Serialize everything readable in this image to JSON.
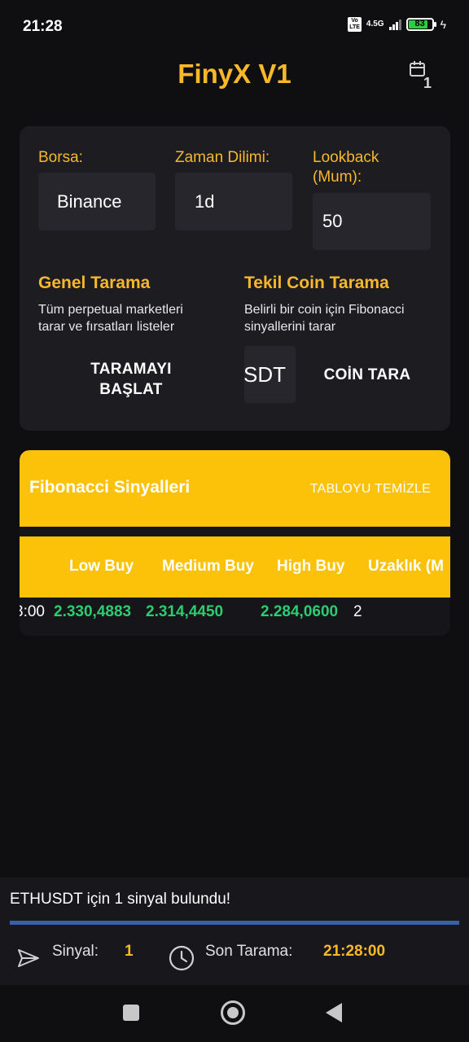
{
  "status_bar": {
    "time": "21:28",
    "volte": "Vo LTE",
    "network": "4.5G",
    "battery_level": "83",
    "battery_fraction": 0.83
  },
  "header": {
    "title": "FinyX V1",
    "calendar_count": "1"
  },
  "settings": {
    "exchange_label": "Borsa:",
    "exchange_value": "Binance",
    "timeframe_label": "Zaman Dilimi:",
    "timeframe_value": "1d",
    "lookback_label": "Lookback (Mum):",
    "lookback_value": "50"
  },
  "general_scan": {
    "title": "Genel Tarama",
    "description": "Tüm perpetual marketleri tarar ve fırsatları listeler",
    "button": "TARAMAYI BAŞLAT"
  },
  "single_scan": {
    "title": "Tekil Coin Tarama",
    "description": "Belirli bir coin için Fibonacci sinyallerini tarar",
    "coin_value": "ETHUSDT",
    "button": "COİN TARA"
  },
  "signals": {
    "title": "Fibonacci Sinyalleri",
    "clear_button": "TABLOYU TEMİZLE",
    "columns": [
      "Low Buy",
      "Medium Buy",
      "High Buy",
      "Uzaklık (M"
    ],
    "rows": [
      {
        "time_fragment": "3:00",
        "low_buy": "2.330,4883",
        "medium_buy": "2.314,4450",
        "high_buy": "2.284,0600",
        "distance": "2"
      }
    ]
  },
  "footer": {
    "message": "ETHUSDT için 1 sinyal bulundu!",
    "progress": 1.0,
    "signal_label": "Sinyal:",
    "signal_count": "1",
    "last_scan_label": "Son Tarama:",
    "last_scan_time": "21:28:00"
  },
  "colors": {
    "accent": "#f7b82b",
    "panel_yellow": "#fcc20a",
    "value_green": "#2ecc71",
    "background": "#0f0f12",
    "card": "#1c1c21"
  }
}
